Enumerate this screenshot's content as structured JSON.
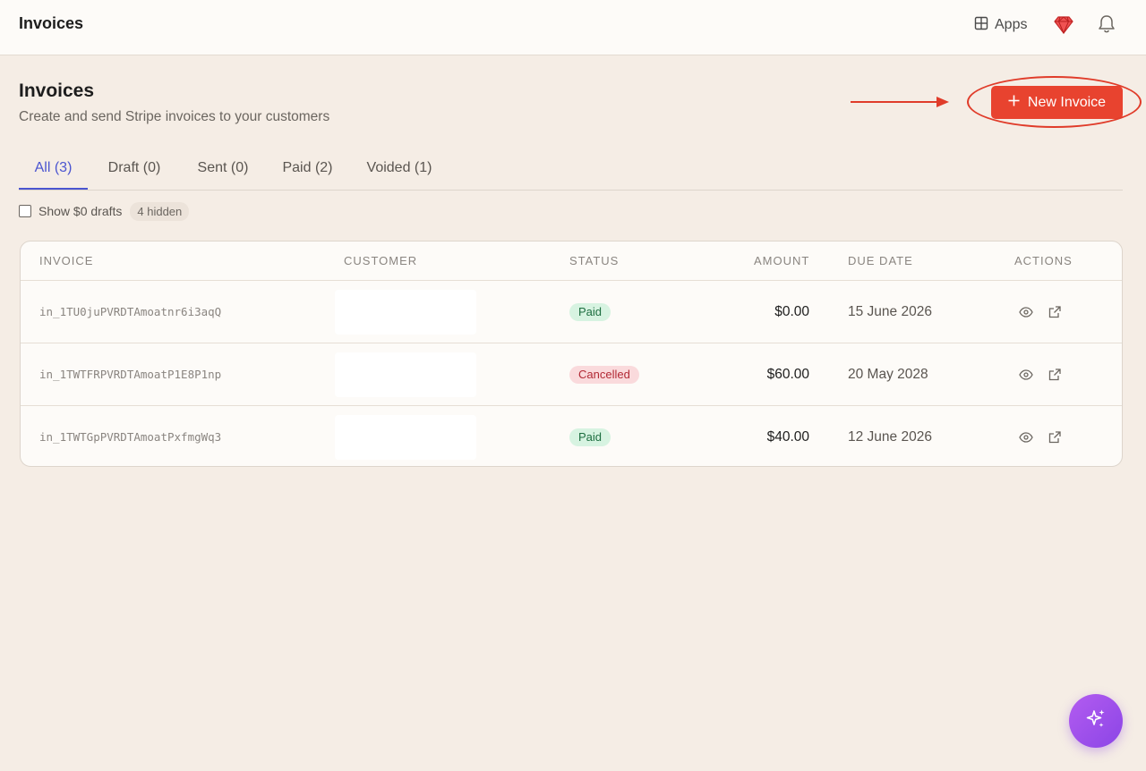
{
  "topbar": {
    "title": "Invoices",
    "apps_label": "Apps",
    "icons": [
      "grid-icon",
      "gem-icon",
      "bell-icon"
    ]
  },
  "page": {
    "title": "Invoices",
    "subtitle": "Create and send Stripe invoices to your customers",
    "new_invoice_label": "New Invoice"
  },
  "tabs": [
    {
      "label": "All (3)",
      "active": true
    },
    {
      "label": "Draft (0)",
      "active": false
    },
    {
      "label": "Sent (0)",
      "active": false
    },
    {
      "label": "Paid (2)",
      "active": false
    },
    {
      "label": "Voided (1)",
      "active": false
    }
  ],
  "filter": {
    "checkbox_label": "Show $0 drafts",
    "checked": false,
    "hidden_badge": "4 hidden"
  },
  "table": {
    "headers": [
      "INVOICE",
      "CUSTOMER",
      "STATUS",
      "AMOUNT",
      "DUE DATE",
      "ACTIONS"
    ],
    "rows": [
      {
        "invoice": "in_1TU0juPVRDTAmoatnr6i3aqQ",
        "customer": "",
        "status": "Paid",
        "amount": "$0.00",
        "due": "15 June 2026"
      },
      {
        "invoice": "in_1TWTFRPVRDTAmoatP1E8P1np",
        "customer": "",
        "status": "Cancelled",
        "amount": "$60.00",
        "due": "20 May 2028"
      },
      {
        "invoice": "in_1TWTGpPVRDTAmoatPxfmgWq3",
        "customer": "",
        "status": "Paid",
        "amount": "$40.00",
        "due": "12 June 2026"
      }
    ]
  },
  "colors": {
    "background": "#f5ede5",
    "accent": "#e8432f",
    "tab_active": "#4b55d0",
    "paid_bg": "#d7f3e1",
    "cancelled_bg": "#fadadc",
    "fab": "#9b4fec"
  }
}
